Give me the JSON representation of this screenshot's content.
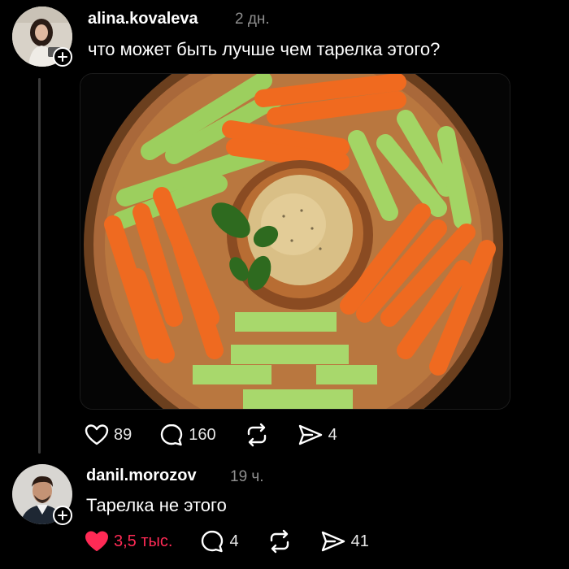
{
  "post": {
    "username": "alina.kovaleva",
    "time": "2 дн.",
    "text": "что может быть лучше чем тарелка этого?",
    "image_alt": "Тарелка с морковными и сельдерейными палочками и хумусом",
    "stats": {
      "likes": "89",
      "comments": "160",
      "reposts": "",
      "shares": "4"
    }
  },
  "reply": {
    "username": "danil.morozov",
    "time": "19 ч.",
    "text": "Тарелка не этого",
    "stats": {
      "likes": "3,5 тыс.",
      "comments": "4",
      "reposts": "",
      "shares": "41"
    },
    "liked": true
  },
  "icons": [
    "heart-icon",
    "comment-icon",
    "repost-icon",
    "share-icon",
    "plus-icon",
    "heart-filled-icon"
  ],
  "colors": {
    "background": "#000000",
    "text": "#ffffff",
    "muted": "#8e8e8e",
    "like": "#ff2a55"
  }
}
